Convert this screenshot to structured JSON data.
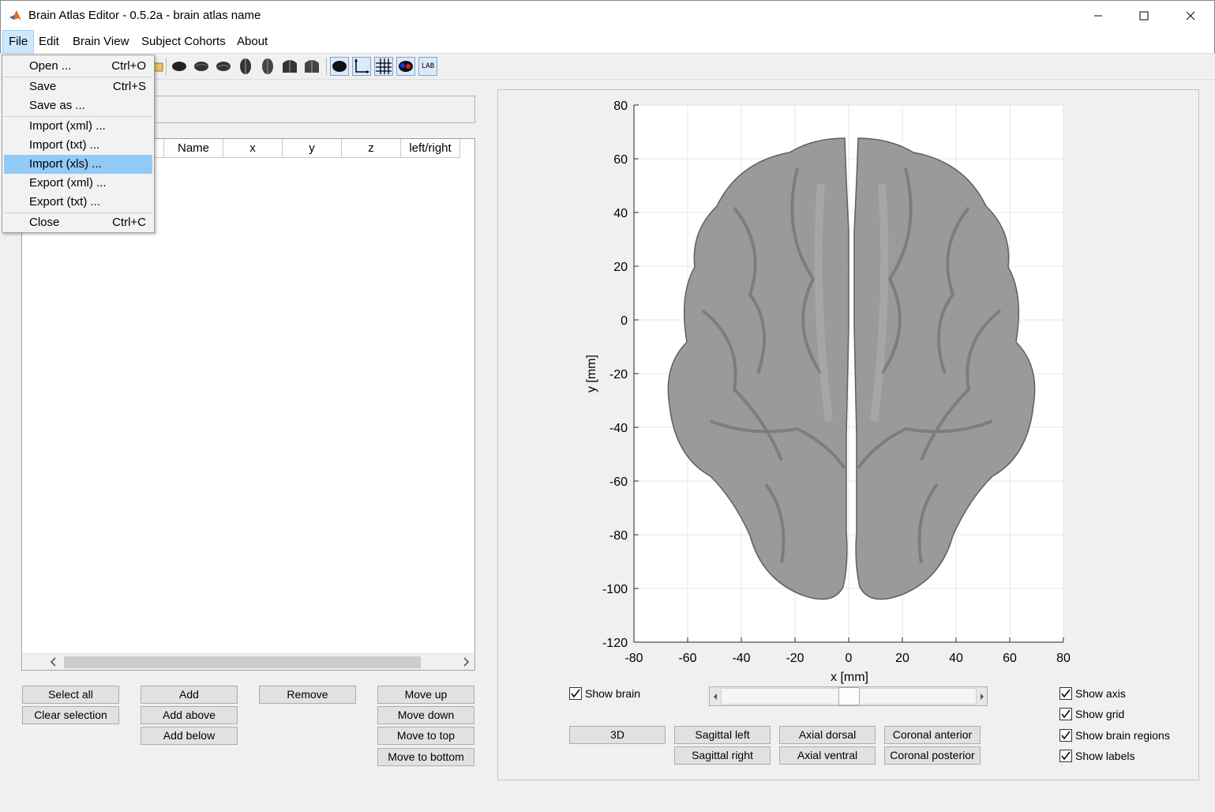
{
  "window": {
    "title": "Brain Atlas Editor - 0.5.2a - brain atlas name"
  },
  "menubar": [
    {
      "label": "File"
    },
    {
      "label": "Edit"
    },
    {
      "label": "Brain View"
    },
    {
      "label": "Subject Cohorts"
    },
    {
      "label": "About"
    }
  ],
  "file_menu": {
    "items": [
      {
        "label": "Open ...",
        "shortcut": "Ctrl+O"
      },
      {
        "label": "Save",
        "shortcut": "Ctrl+S"
      },
      {
        "label": "Save as ...",
        "shortcut": ""
      },
      {
        "label": "Import (xml) ...",
        "shortcut": ""
      },
      {
        "label": "Import (txt) ...",
        "shortcut": ""
      },
      {
        "label": "Import (xls) ...",
        "shortcut": "",
        "highlighted": true
      },
      {
        "label": "Export (xml) ...",
        "shortcut": ""
      },
      {
        "label": "Export (txt) ...",
        "shortcut": ""
      },
      {
        "label": "Close",
        "shortcut": "Ctrl+C"
      }
    ]
  },
  "toolbar": {
    "lab_label": "LAB",
    "icons": [
      "open-icon",
      "brain-view-icons",
      "brain-icon",
      "axis-icon",
      "grid-icon",
      "regions-icon",
      "labels-icon"
    ]
  },
  "table": {
    "columns": [
      "Name",
      "x",
      "y",
      "z",
      "left/right"
    ]
  },
  "buttons": {
    "select_all": "Select all",
    "clear_selection": "Clear selection",
    "add": "Add",
    "add_above": "Add above",
    "add_below": "Add below",
    "remove": "Remove",
    "move_up": "Move up",
    "move_down": "Move down",
    "move_to_top": "Move to top",
    "move_to_bottom": "Move to bottom"
  },
  "view": {
    "show_brain": "Show brain",
    "show_axis": "Show axis",
    "show_grid": "Show grid",
    "show_brain_regions": "Show brain regions",
    "show_labels": "Show labels",
    "btn_3d": "3D",
    "sagittal_left": "Sagittal left",
    "sagittal_right": "Sagittal right",
    "axial_dorsal": "Axial dorsal",
    "axial_ventral": "Axial ventral",
    "coronal_anterior": "Coronal anterior",
    "coronal_posterior": "Coronal posterior",
    "checks": {
      "brain": true,
      "axis": true,
      "grid": true,
      "regions": true,
      "labels": true
    },
    "slider_value": 0.5
  },
  "plot": {
    "xlabel": "x [mm]",
    "ylabel": "y [mm]",
    "xticks": [
      "-80",
      "-60",
      "-40",
      "-20",
      "0",
      "20",
      "40",
      "60",
      "80"
    ],
    "yticks": [
      "80",
      "60",
      "40",
      "20",
      "0",
      "-20",
      "-40",
      "-60",
      "-80",
      "-100",
      "-120"
    ],
    "xlim": [
      -80,
      80
    ],
    "ylim": [
      -120,
      80
    ],
    "grid": true
  }
}
